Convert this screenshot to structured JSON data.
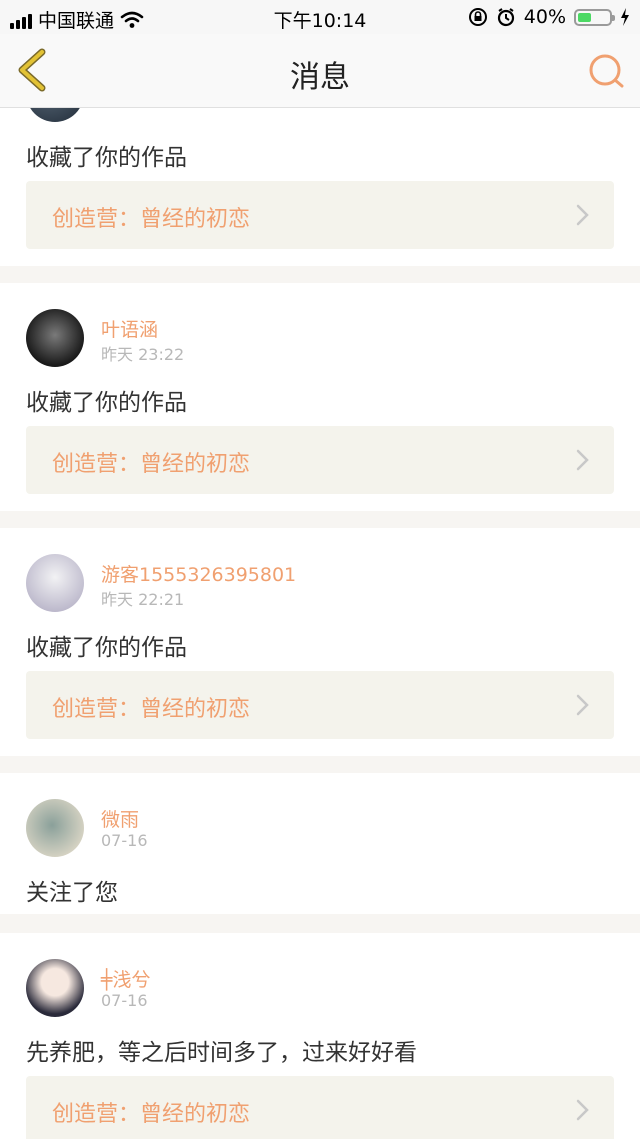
{
  "status_bar": {
    "carrier": "中国联通",
    "time": "下午10:14",
    "battery_percent": "40%",
    "battery_level": 0.4
  },
  "navbar": {
    "title": "消息",
    "back_icon": "chevron-left-icon",
    "search_icon": "search-icon"
  },
  "messages": [
    {
      "user": "",
      "time": "",
      "text": "收藏了你的作品",
      "work": "创造营：曾经的初恋"
    },
    {
      "user": "叶语涵",
      "time": "昨天 23:22",
      "text": "收藏了你的作品",
      "work": "创造营：曾经的初恋"
    },
    {
      "user": "游客1555326395801",
      "time": "昨天 22:21",
      "text": "收藏了你的作品",
      "work": "创造营：曾经的初恋"
    },
    {
      "user": "微雨",
      "time": "07-16",
      "text": "关注了您"
    },
    {
      "user": "╪浅兮",
      "time": "07-16",
      "text": "先养肥，等之后时间多了，过来好好看",
      "work": "创造营：曾经的初恋"
    }
  ],
  "colors": {
    "accent": "#f0a070",
    "ref_background": "#f4f3ec",
    "back_icon": "#e2c234"
  }
}
